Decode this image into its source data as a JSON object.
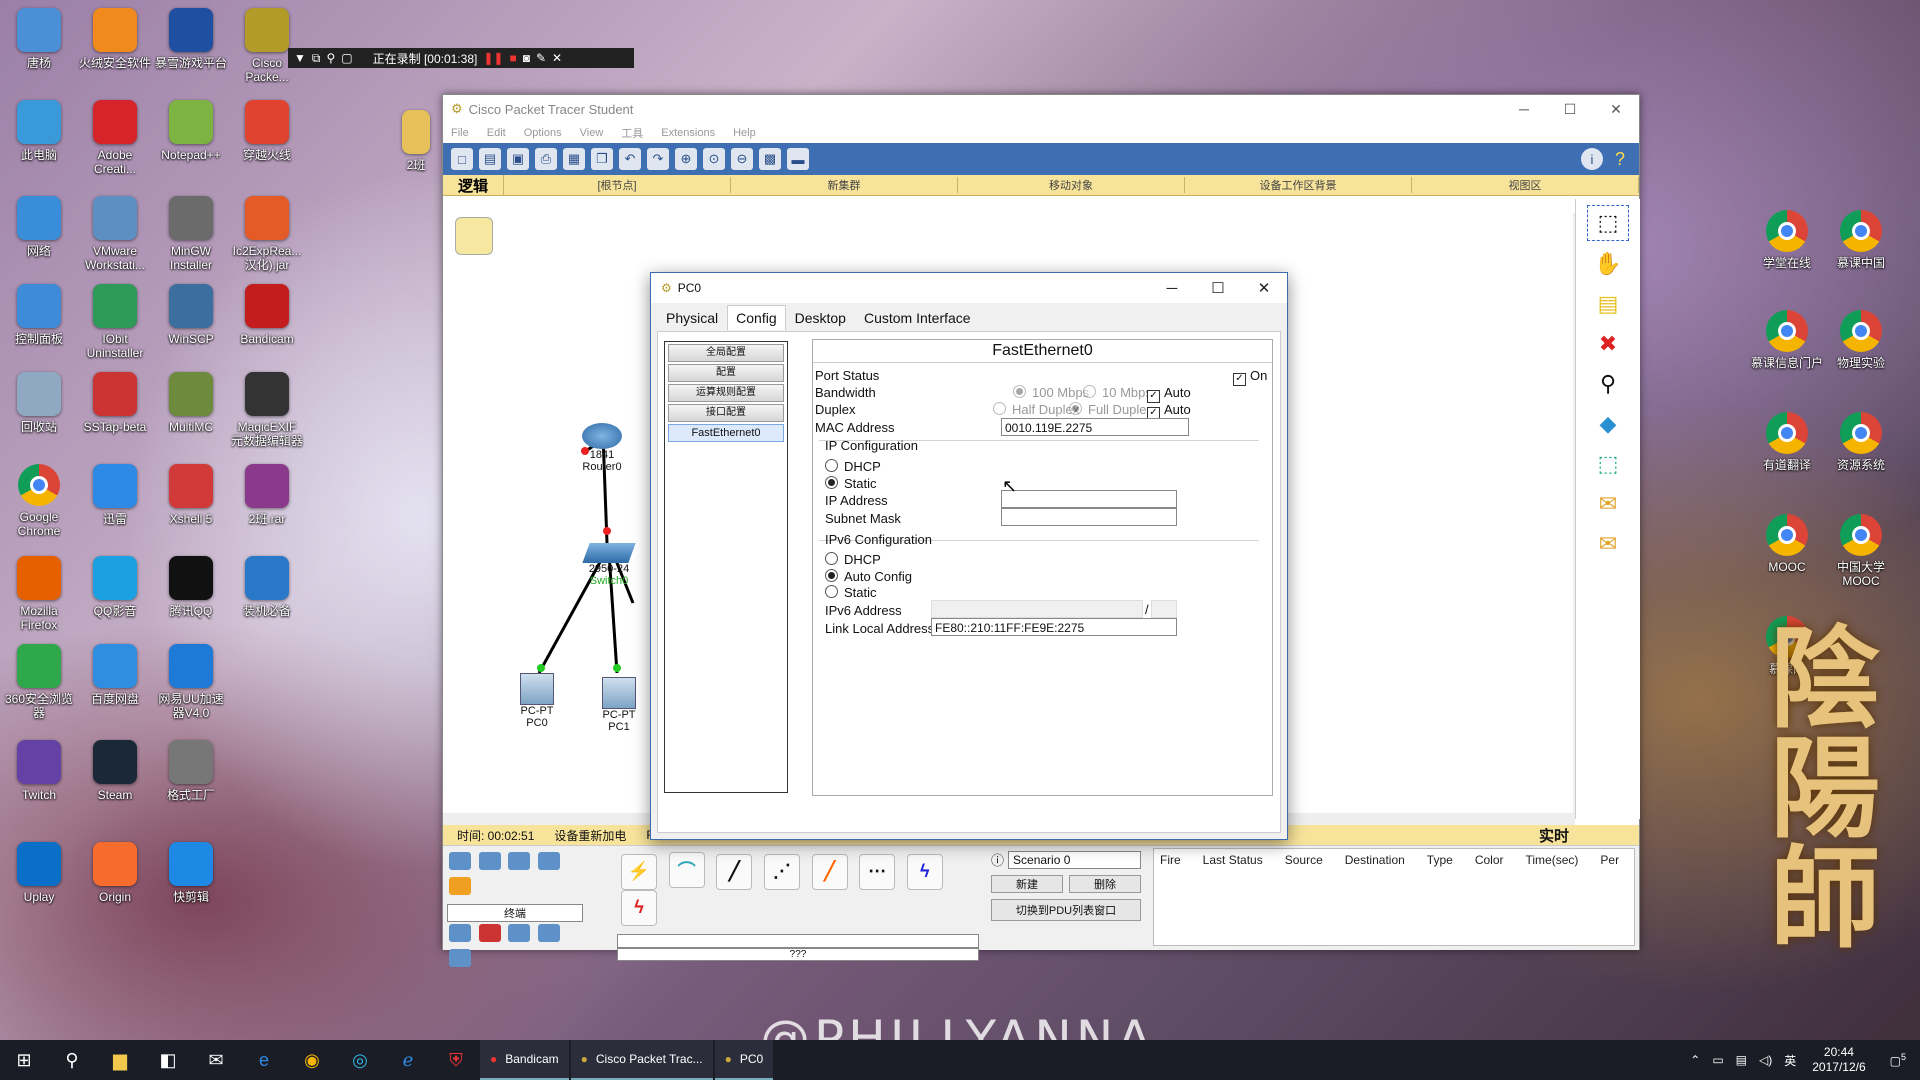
{
  "desktop": {
    "left_icons": [
      {
        "label": "唐杨",
        "icon": "user-icon",
        "color": "#4b8fd6"
      },
      {
        "label": "火绒安全软件",
        "icon": "fire-icon",
        "color": "#f08a1d"
      },
      {
        "label": "暴雪游戏平台",
        "icon": "blizzard-icon",
        "color": "#1f4fa0"
      },
      {
        "label": "Cisco Packe...",
        "icon": "cisco-icon",
        "color": "#b39b2a"
      },
      {
        "label": "此电脑",
        "icon": "computer-icon",
        "color": "#3a9ad9"
      },
      {
        "label": "Adobe Creati...",
        "icon": "adobe-icon",
        "color": "#d6242a"
      },
      {
        "label": "Notepad++",
        "icon": "notepad-icon",
        "color": "#7cb342"
      },
      {
        "label": "穿越火线",
        "icon": "cf-icon",
        "color": "#e0432f"
      },
      {
        "label": "网络",
        "icon": "network-icon",
        "color": "#3a8dd8"
      },
      {
        "label": "VMware Workstati...",
        "icon": "vmware-icon",
        "color": "#5e8fc3"
      },
      {
        "label": "MinGW Installer",
        "icon": "mingw-icon",
        "color": "#6b6b6b"
      },
      {
        "label": "Ic2ExpRea... 汉化).jar",
        "icon": "java-icon",
        "color": "#e55b28"
      },
      {
        "label": "控制面板",
        "icon": "control-panel-icon",
        "color": "#3d8bd9"
      },
      {
        "label": "IObit Uninstaller",
        "icon": "iobit-icon",
        "color": "#2e9a5a"
      },
      {
        "label": "WinSCP",
        "icon": "winscp-icon",
        "color": "#3c6e9f"
      },
      {
        "label": "Bandicam",
        "icon": "bandicam-icon",
        "color": "#c41d1d"
      },
      {
        "label": "回收站",
        "icon": "recycle-bin-icon",
        "color": "#8fa9c2"
      },
      {
        "label": "SSTap-beta",
        "icon": "sstap-icon",
        "color": "#c33"
      },
      {
        "label": "MultiMC",
        "icon": "multimc-icon",
        "color": "#6e8b3d"
      },
      {
        "label": "MagicEXIF 元数据编辑器",
        "icon": "camera-icon",
        "color": "#333"
      },
      {
        "label": "Google Chrome",
        "icon": "chrome-icon",
        "color": "#4285f4"
      },
      {
        "label": "迅雷",
        "icon": "thunder-icon",
        "color": "#2f8ae5"
      },
      {
        "label": "Xshell 5",
        "icon": "xshell-icon",
        "color": "#d23a3a"
      },
      {
        "label": "2班.rar",
        "icon": "rar-icon",
        "color": "#8b3a8b"
      },
      {
        "label": "Mozilla Firefox",
        "icon": "firefox-icon",
        "color": "#e66000"
      },
      {
        "label": "QQ影音",
        "icon": "qqplayer-icon",
        "color": "#1ba1e2"
      },
      {
        "label": "腾讯QQ",
        "icon": "qq-icon",
        "color": "#111"
      },
      {
        "label": "装机必备",
        "icon": "app-icon",
        "color": "#2a78c8"
      },
      {
        "label": "360安全浏览器",
        "icon": "browser-360-icon",
        "color": "#2ea84a"
      },
      {
        "label": "百度网盘",
        "icon": "baidu-pan-icon",
        "color": "#2f8ee0"
      },
      {
        "label": "网易UU加速器V4.0",
        "icon": "uu-icon",
        "color": "#1e7ad6"
      },
      {
        "label": "Twitch",
        "icon": "twitch-icon",
        "color": "#6441a5"
      },
      {
        "label": "Steam",
        "icon": "steam-icon",
        "color": "#1b2838"
      },
      {
        "label": "格式工厂",
        "icon": "format-factory-icon",
        "color": "#777"
      },
      {
        "label": "Uplay",
        "icon": "uplay-icon",
        "color": "#0b6fc8"
      },
      {
        "label": "Origin",
        "icon": "origin-icon",
        "color": "#f56c2d"
      },
      {
        "label": "快剪辑",
        "icon": "video-edit-icon",
        "color": "#1e88e5"
      }
    ],
    "right_icons": [
      {
        "label": "学堂在线"
      },
      {
        "label": "慕课中国"
      },
      {
        "label": "慕课信息门户"
      },
      {
        "label": "物理实验"
      },
      {
        "label": "有道翻译"
      },
      {
        "label": "资源系统"
      },
      {
        "label": "MOOC"
      },
      {
        "label": "中国大学MOOC"
      },
      {
        "label": "慕课网"
      }
    ],
    "folder_label": "2班",
    "watermark": "@PHILLYANNA-"
  },
  "recording": {
    "status": "正在录制 [00:01:38]"
  },
  "packet_tracer": {
    "title": "Cisco Packet Tracer Student",
    "menu": [
      "File",
      "Edit",
      "Options",
      "View",
      "工具",
      "Extensions",
      "Help"
    ],
    "logic_tab": "逻辑",
    "yellow_bar": [
      "[根节点]",
      "新集群",
      "移动对象",
      "设备工作区背景",
      "视图区"
    ],
    "devices": [
      {
        "name": "1841",
        "sub": "Router0"
      },
      {
        "name": "2950-24",
        "sub": "Switch0"
      },
      {
        "name": "PC-PT",
        "sub": "PC0"
      },
      {
        "name": "PC-PT",
        "sub": "PC1"
      }
    ],
    "time_label": "时间: 00:02:51",
    "power_label": "设备重新加电",
    "fwd_label": "Fa",
    "realtime": "实时",
    "category_label": "终端",
    "unknown_label": "???",
    "scenario": "Scenario 0",
    "new_btn": "新建",
    "delete_btn": "删除",
    "pdu_toggle": "切换到PDU列表窗口",
    "pdu_columns": [
      "Fire",
      "Last Status",
      "Source",
      "Destination",
      "Type",
      "Color",
      "Time(sec)",
      "Per"
    ]
  },
  "dialog": {
    "title": "PC0",
    "tabs": [
      "Physical",
      "Config",
      "Desktop",
      "Custom Interface"
    ],
    "active_tab": "Config",
    "nav": [
      "全局配置",
      "配置",
      "运算规则配置",
      "接口配置",
      "FastEthernet0"
    ],
    "heading": "FastEthernet0",
    "port_status_label": "Port Status",
    "port_status_on": "On",
    "bandwidth_label": "Bandwidth",
    "bw_100": "100 Mbps",
    "bw_10": "10 Mbps",
    "auto": "Auto",
    "duplex_label": "Duplex",
    "half": "Half Duplex",
    "full": "Full Duplex",
    "mac_label": "MAC Address",
    "mac_value": "0010.119E.2275",
    "ip_config": "IP Configuration",
    "dhcp": "DHCP",
    "static": "Static",
    "ip_label": "IP Address",
    "ip_value": "",
    "mask_label": "Subnet Mask",
    "mask_value": "",
    "ipv6_config": "IPv6 Configuration",
    "auto_config": "Auto Config",
    "ipv6_label": "IPv6 Address",
    "ipv6_sep": "/",
    "link_local_label": "Link Local Address:",
    "link_local_value": "FE80::210:11FF:FE9E:2275"
  },
  "taskbar": {
    "apps": [
      {
        "label": "Bandicam",
        "icon": "bandicam-icon"
      },
      {
        "label": "Cisco Packet Trac...",
        "icon": "cisco-icon"
      },
      {
        "label": "PC0",
        "icon": "cisco-icon"
      }
    ],
    "ime": "英",
    "time": "20:44",
    "date": "2017/12/6",
    "notif": "5"
  }
}
